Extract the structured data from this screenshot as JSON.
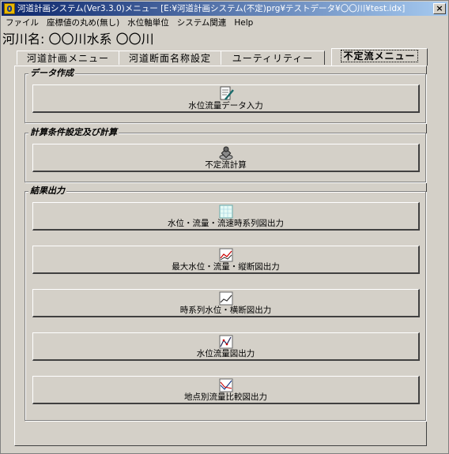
{
  "window": {
    "title": "河道計画システム(Ver3.3.0)メニュー [E:¥河道計画システム(不定)prg¥テストデータ¥〇〇川¥test.idx]",
    "close_label": "×"
  },
  "menu": [
    "ファイル",
    "座標値の丸め(無し)",
    "水位軸単位",
    "システム関連",
    "Help"
  ],
  "river_name": "河川名: 〇〇川水系 〇〇川",
  "tabs": [
    {
      "label": "河道計画メニュー",
      "active": false
    },
    {
      "label": "河道断面名称設定",
      "active": false
    },
    {
      "label": "ユーティリティー",
      "active": false
    },
    {
      "label": "不定流メニュー",
      "active": true
    }
  ],
  "groups": {
    "data": {
      "title": "データ作成",
      "buttons": [
        {
          "label": "水位流量データ入力",
          "icon": "document-pen-icon"
        }
      ]
    },
    "calc": {
      "title": "計算条件設定及び計算",
      "buttons": [
        {
          "label": "不定流計算",
          "icon": "stamp-icon"
        }
      ]
    },
    "output": {
      "title": "結果出力",
      "buttons": [
        {
          "label": "水位・流量・流速時系列図出力",
          "icon": "chart-icon"
        },
        {
          "label": "最大水位・流量・縦断図出力",
          "icon": "line-chart-icon"
        },
        {
          "label": "時系列水位・横断図出力",
          "icon": "line-chart-icon"
        },
        {
          "label": "水位流量図出力",
          "icon": "scatter-chart-icon"
        },
        {
          "label": "地点別流量比較図出力",
          "icon": "line-chart-icon"
        }
      ]
    }
  }
}
